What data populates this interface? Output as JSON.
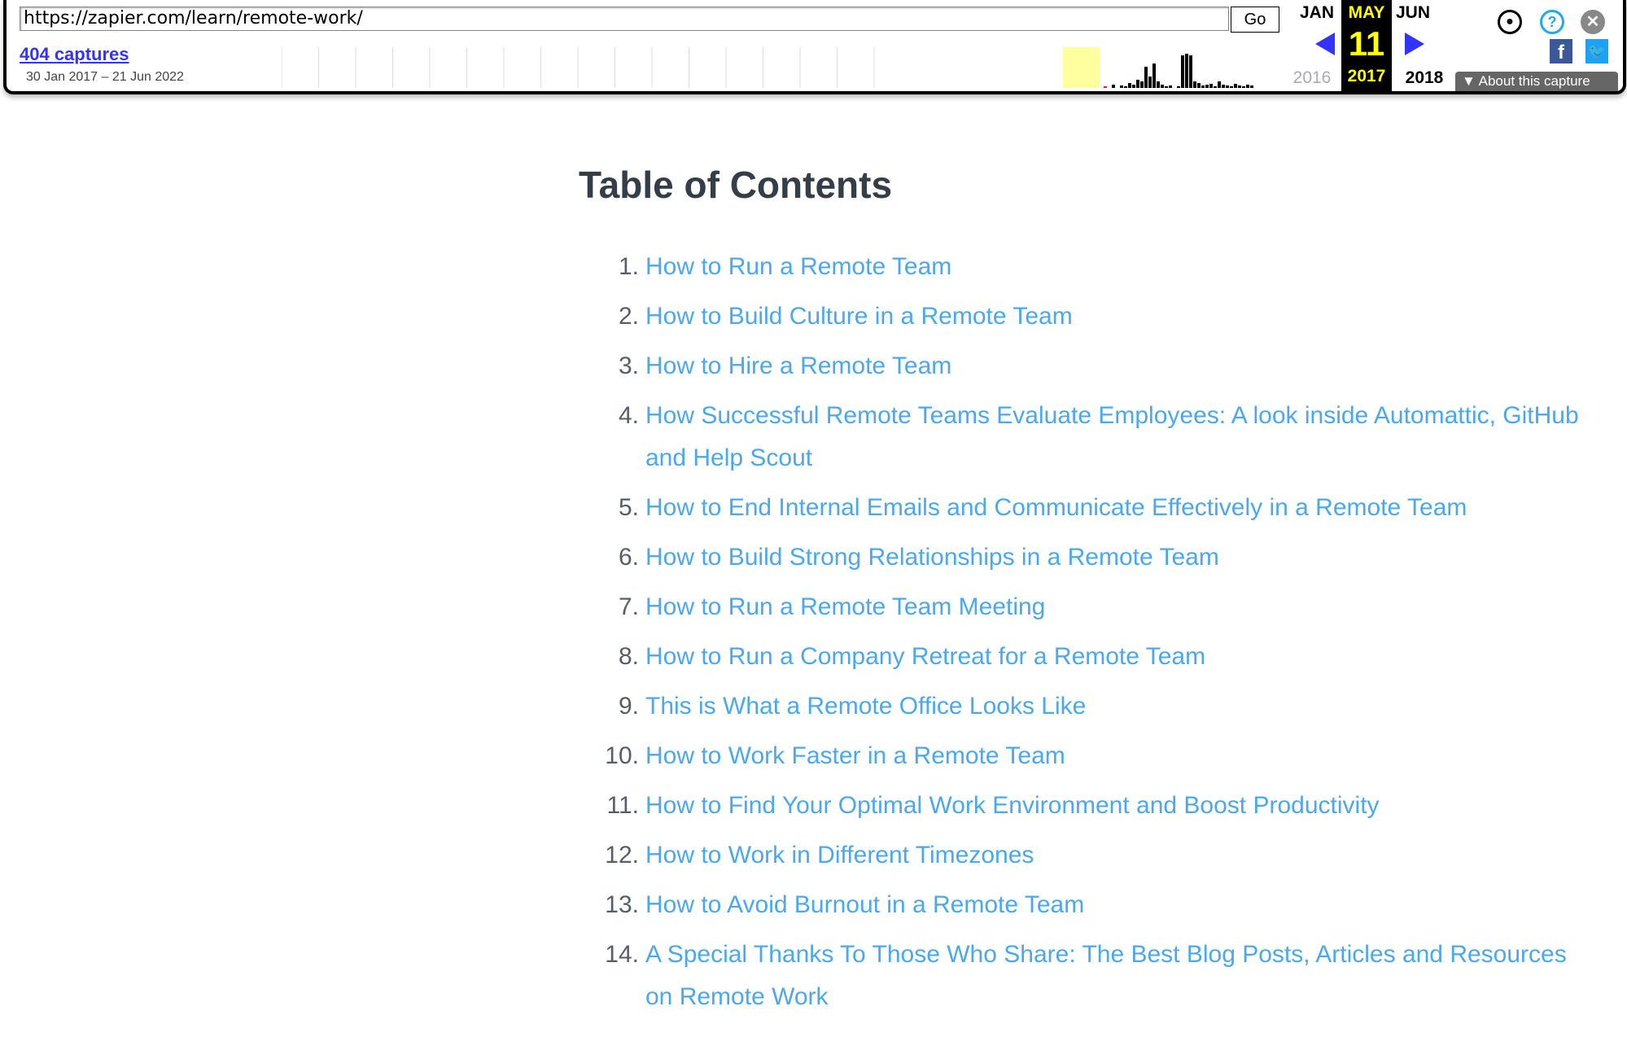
{
  "wayback": {
    "url": "https://zapier.com/learn/remote-work/",
    "go_label": "Go",
    "captures_label": "404 captures",
    "date_range": "30 Jan 2017 – 21 Jun 2022",
    "prev_month": "JAN",
    "current_month": "MAY",
    "next_month": "JUN",
    "current_day": "11",
    "prev_year": "2016",
    "current_year": "2017",
    "next_year": "2018",
    "about_label": "About this capture",
    "accent": "#ffff00",
    "arrow_color": "#3333ff"
  },
  "page": {
    "title": "Table of Contents",
    "link_color": "#4aa8f0",
    "items": [
      {
        "num": "1.",
        "label": "How to Run a Remote Team"
      },
      {
        "num": "2.",
        "label": "How to Build Culture in a Remote Team"
      },
      {
        "num": "3.",
        "label": "How to Hire a Remote Team"
      },
      {
        "num": "4.",
        "label": "How Successful Remote Teams Evaluate Employees: A look inside Automattic, GitHub and Help Scout"
      },
      {
        "num": "5.",
        "label": "How to End Internal Emails and Communicate Effectively in a Remote Team"
      },
      {
        "num": "6.",
        "label": "How to Build Strong Relationships in a Remote Team"
      },
      {
        "num": "7.",
        "label": "How to Run a Remote Team Meeting"
      },
      {
        "num": "8.",
        "label": "How to Run a Company Retreat for a Remote Team"
      },
      {
        "num": "9.",
        "label": "This is What a Remote Office Looks Like"
      },
      {
        "num": "10.",
        "label": "How to Work Faster in a Remote Team"
      },
      {
        "num": "11.",
        "label": "How to Find Your Optimal Work Environment and Boost Productivity"
      },
      {
        "num": "12.",
        "label": "How to Work in Different Timezones"
      },
      {
        "num": "13.",
        "label": "How to Avoid Burnout in a Remote Team"
      },
      {
        "num": "14.",
        "label": "A Special Thanks To Those Who Share: The Best Blog Posts, Articles and Resources on Remote Work"
      }
    ]
  }
}
